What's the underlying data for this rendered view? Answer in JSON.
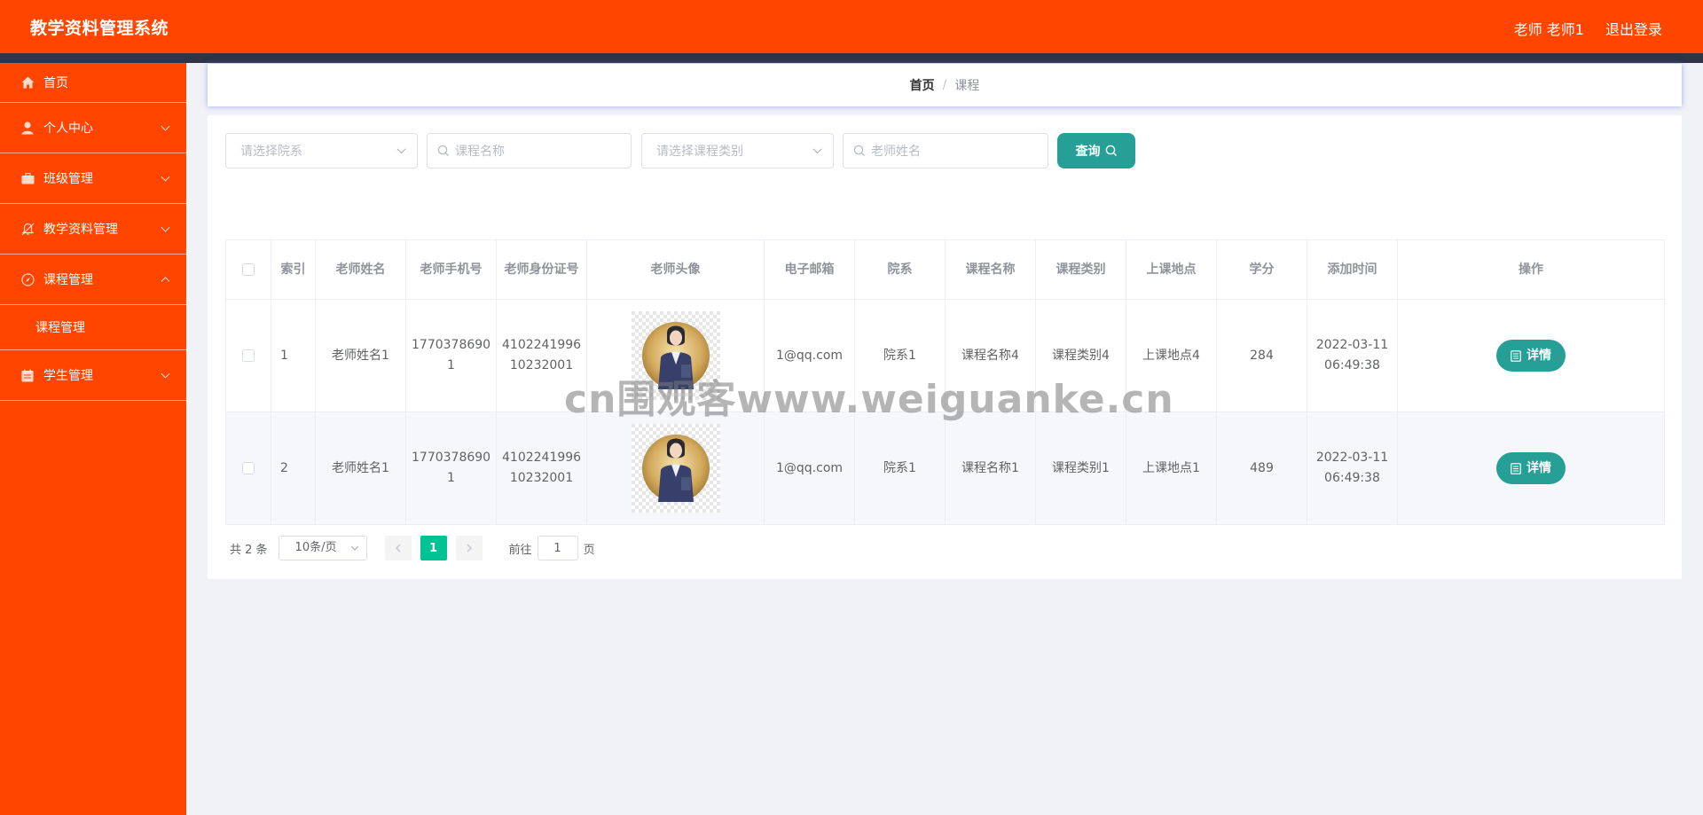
{
  "app": {
    "title": "教学资料管理系统"
  },
  "header": {
    "user": "老师 老师1",
    "logout": "退出登录"
  },
  "sidebar": {
    "items": [
      {
        "label": "首页",
        "icon": "home-icon"
      },
      {
        "label": "个人中心",
        "icon": "user-icon"
      },
      {
        "label": "班级管理",
        "icon": "briefcase-icon"
      },
      {
        "label": "教学资料管理",
        "icon": "bell-off-icon"
      },
      {
        "label": "课程管理",
        "icon": "compass-icon"
      },
      {
        "label": "学生管理",
        "icon": "calendar-icon"
      }
    ],
    "submenu": {
      "label": "课程管理"
    }
  },
  "breadcrumb": {
    "home": "首页",
    "separator": "/",
    "current": "课程"
  },
  "filters": {
    "department_placeholder": "请选择院系",
    "course_name_placeholder": "课程名称",
    "course_type_placeholder": "请选择课程类别",
    "teacher_name_placeholder": "老师姓名",
    "query_label": "查询"
  },
  "table": {
    "headers": [
      "索引",
      "老师姓名",
      "老师手机号",
      "老师身份证号",
      "老师头像",
      "电子邮箱",
      "院系",
      "课程名称",
      "课程类别",
      "上课地点",
      "学分",
      "添加时间",
      "操作"
    ],
    "rows": [
      {
        "index": "1",
        "teacher_name": "老师姓名1",
        "phone_1": "1770378690",
        "phone_2": "1",
        "id_1": "4102241996",
        "id_2": "10232001",
        "email": "1@qq.com",
        "department": "院系1",
        "course_name": "课程名称4",
        "course_type": "课程类别4",
        "location": "上课地点4",
        "credits": "284",
        "date": "2022-03-11",
        "time": "06:49:38",
        "action": "详情"
      },
      {
        "index": "2",
        "teacher_name": "老师姓名1",
        "phone_1": "1770378690",
        "phone_2": "1",
        "id_1": "4102241996",
        "id_2": "10232001",
        "email": "1@qq.com",
        "department": "院系1",
        "course_name": "课程名称1",
        "course_type": "课程类别1",
        "location": "上课地点1",
        "credits": "489",
        "date": "2022-03-11",
        "time": "06:49:38",
        "action": "详情"
      }
    ]
  },
  "pagination": {
    "total": "共 2 条",
    "page_size": "10条/页",
    "current_page": "1",
    "goto_prefix": "前往",
    "goto_value": "1",
    "goto_suffix": "页"
  },
  "watermark": "cn围观客www.weiguanke.cn",
  "colors": {
    "brand": "#ff4500",
    "dark_strip": "#2f3447",
    "button": "#26a096",
    "active_page": "#00c292"
  }
}
